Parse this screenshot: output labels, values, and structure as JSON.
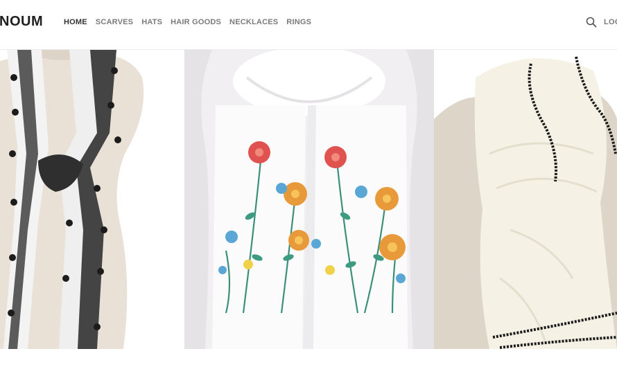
{
  "brand": {
    "logo_text": "NOUM"
  },
  "nav": {
    "items": [
      {
        "label": "HOME",
        "active": true
      },
      {
        "label": "SCARVES",
        "active": false
      },
      {
        "label": "HATS",
        "active": false
      },
      {
        "label": "HAIR GOODS",
        "active": false
      },
      {
        "label": "NECKLACES",
        "active": false
      },
      {
        "label": "RINGS",
        "active": false
      }
    ]
  },
  "header_right": {
    "search_icon": "search-icon",
    "login_label": "LOGIN"
  },
  "gallery": {
    "images": [
      {
        "name": "tie-dye-pompom-scarf",
        "colors": [
          "#f2f2f2",
          "#4a4a4a",
          "#1f1f1f"
        ]
      },
      {
        "name": "floral-embroidered-scarf",
        "colors": [
          "#f7f7f7",
          "#e0524f",
          "#3a8f7a",
          "#e89a3a",
          "#5aa7d6"
        ]
      },
      {
        "name": "cream-trim-scarf",
        "colors": [
          "#f5f1e4",
          "#111111"
        ]
      }
    ]
  }
}
